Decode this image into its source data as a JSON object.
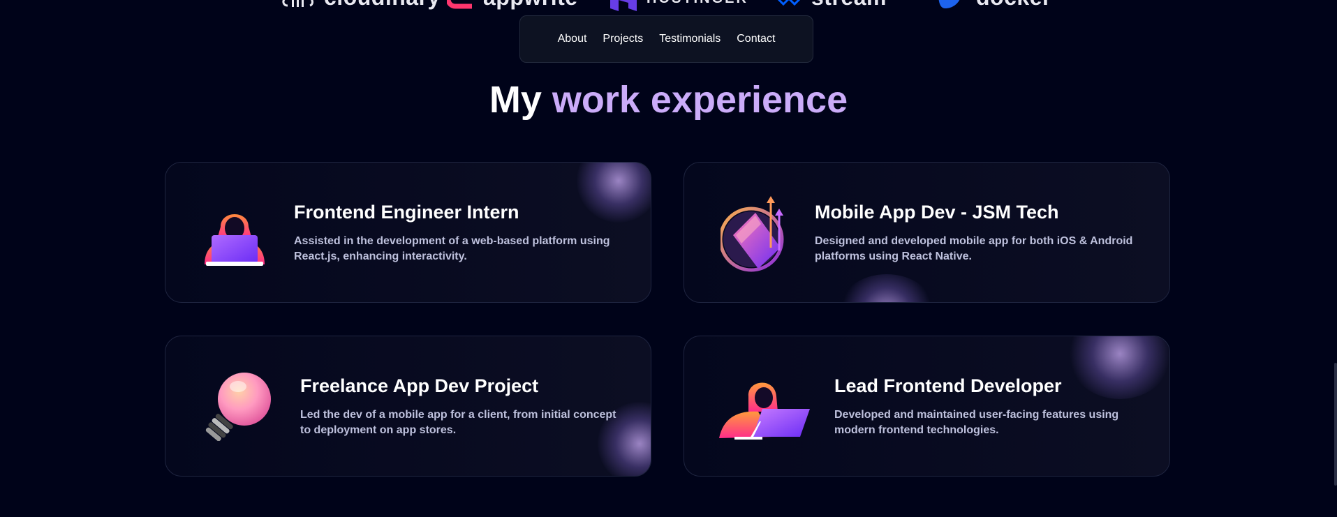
{
  "logos": [
    {
      "name": "cloudinary",
      "label": "cloudinary"
    },
    {
      "name": "appwrite",
      "label": "appwrite"
    },
    {
      "name": "hostinger",
      "label": "HOSTINGER"
    },
    {
      "name": "stream",
      "label": "stream"
    },
    {
      "name": "docker",
      "label": "docker"
    }
  ],
  "nav": {
    "items": [
      "About",
      "Projects",
      "Testimonials",
      "Contact"
    ]
  },
  "heading": {
    "prefix": "My",
    "accent": "work experience"
  },
  "experience": [
    {
      "icon": "hooded-coder-laptop-icon",
      "title": "Frontend Engineer Intern",
      "description": "Assisted in the development of a web-based platform using React.js, enhancing interactivity."
    },
    {
      "icon": "laptop-growth-arrows-icon",
      "title": "Mobile App Dev - JSM Tech",
      "description": "Designed and developed mobile app for both iOS & Android platforms using React Native."
    },
    {
      "icon": "lightbulb-icon",
      "title": "Freelance App Dev Project",
      "description": "Led the dev of a mobile app for a client, from initial concept to deployment on app stores."
    },
    {
      "icon": "hooded-developer-laptop-icon",
      "title": "Lead Frontend Developer",
      "description": "Developed and maintained user-facing features using modern frontend technologies."
    }
  ],
  "colors": {
    "background": "#000319",
    "accent": "#cbacf9",
    "card_border": "#1f2540",
    "description_text": "#bec1dd"
  }
}
